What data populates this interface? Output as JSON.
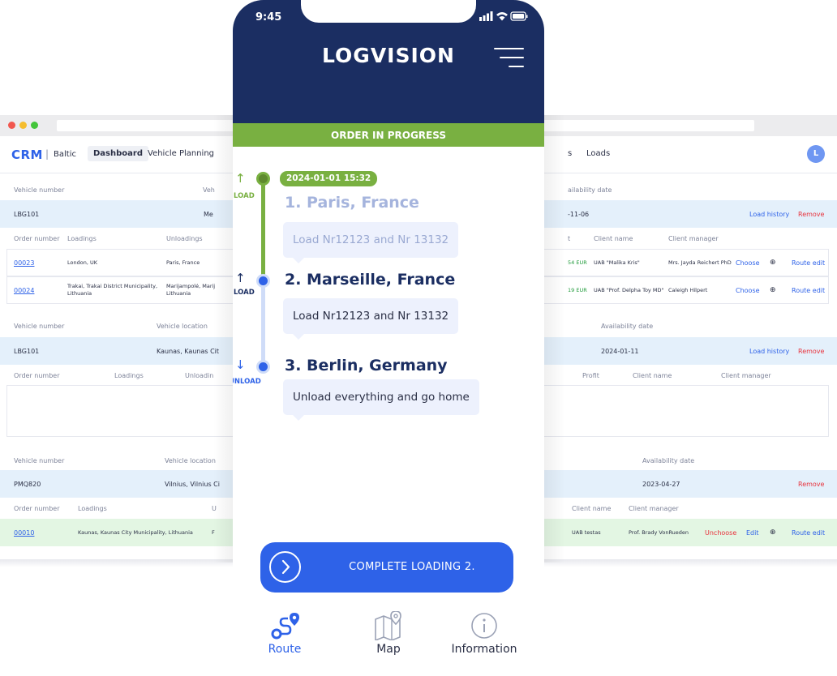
{
  "crm": {
    "logo": "CRM",
    "separator": "|",
    "region": "Baltic",
    "nav": {
      "dashboard": "Dashboard",
      "vehicle_planning": "Vehicle Planning",
      "partial": "s",
      "loads": "Loads"
    },
    "avatar_initial": "L",
    "colors": {
      "accent": "#2e62e8",
      "remove": "#e8323c",
      "profit": "#1f9a3a"
    },
    "section1": {
      "vehicle_number_label": "Vehicle number",
      "vehicle_location_label_partial": "Veh",
      "availability_label_partial": "ailability date",
      "vehicle_number": "LBG101",
      "vehicle_location_partial": "Me",
      "availability_partial": "-11-06",
      "load_history": "Load history",
      "remove": "Remove",
      "headers": {
        "order_number": "Order number",
        "loadings": "Loadings",
        "unloadings": "Unloadings",
        "profit_partial": "t",
        "client_name": "Client name",
        "client_manager": "Client manager"
      },
      "orders": [
        {
          "order": "00023",
          "loading": "London, UK",
          "unloading": "Paris, France",
          "profit_partial": "54 EUR",
          "client": "UAB \"Malika Kris\"",
          "manager": "Mrs. Jayda Reichert PhD",
          "choose": "Choose",
          "route_edit": "Route edit"
        },
        {
          "order": "00024",
          "loading": "Trakai, Trakai District Municipality, Lithuania",
          "loading_line1": "Trakai, Trakai District Municipality,",
          "loading_line2": "Lithuania",
          "unloading_line1": "Marijampolė, Marij",
          "unloading_line2": "Lithuania",
          "profit_partial": "19 EUR",
          "client": "UAB \"Prof. Delpha Toy MD\"",
          "manager": "Caleigh Hilpert",
          "choose": "Choose",
          "route_edit": "Route edit"
        }
      ]
    },
    "section2": {
      "vehicle_number_label": "Vehicle number",
      "vehicle_location_label": "Vehicle location",
      "availability_label": "Availability date",
      "vehicle_number": "LBG101",
      "vehicle_location_partial": "Kaunas, Kaunas Cit",
      "availability": "2024-01-11",
      "load_history": "Load history",
      "remove": "Remove",
      "headers": {
        "order_number": "Order number",
        "loadings": "Loadings",
        "unloadings_partial": "Unloadin",
        "profit": "Profit",
        "client_name": "Client name",
        "client_manager": "Client manager"
      }
    },
    "section3": {
      "vehicle_number_label": "Vehicle number",
      "vehicle_location_label_partial": "Vehicle location",
      "availability_label": "Availability date",
      "vehicle_number": "PMQ820",
      "vehicle_location_partial": "Vilnius, Vilnius Ci",
      "availability": "2023-04-27",
      "remove": "Remove",
      "headers": {
        "order_number": "Order number",
        "loadings": "Loadings",
        "unloadings_partial": "U",
        "client_name": "Client name",
        "client_manager": "Client manager"
      },
      "order": {
        "order": "00010",
        "loading": "Kaunas, Kaunas City Municipality, Lithuania",
        "unloading_partial": "F",
        "client": "UAB testas",
        "manager": "Prof. Brady VonRueden",
        "unchoose": "Unchoose",
        "edit": "Edit",
        "route_edit": "Route edit"
      }
    }
  },
  "phone": {
    "time": "9:45",
    "brand": "LOGVISION",
    "status_banner": "ORDER IN PROGRESS",
    "colors": {
      "header": "#1b2e62",
      "banner": "#79b041",
      "primary": "#2e62e8"
    },
    "date_badge": "2024-01-01  15:32",
    "stops": [
      {
        "arrow": "↑",
        "action": "LOAD",
        "title": "1. Paris, France",
        "note": "Load Nr12123 and Nr 13132",
        "state": "done"
      },
      {
        "arrow": "↑",
        "action": "LOAD",
        "title": "2. Marseille, France",
        "note": "Load Nr12123 and Nr 13132",
        "state": "current"
      },
      {
        "arrow": "↓",
        "action": "UNLOAD",
        "title": "3. Berlin, Germany",
        "note": "Unload everything and go home",
        "state": "pending"
      }
    ],
    "complete_button": "COMPLETE LOADING 2.",
    "tabs": [
      {
        "label": "Route",
        "icon": "route-icon",
        "active": true
      },
      {
        "label": "Map",
        "icon": "map-icon",
        "active": false
      },
      {
        "label": "Information",
        "icon": "info-icon",
        "active": false
      }
    ]
  }
}
